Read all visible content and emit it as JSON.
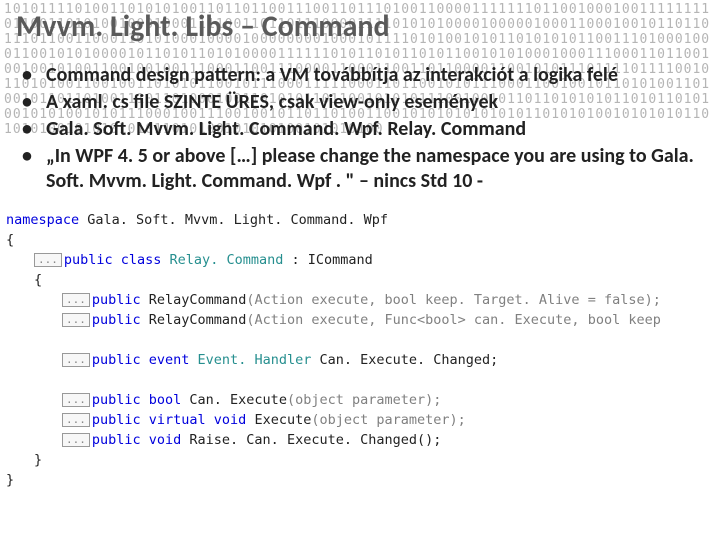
{
  "bg_binary": "10101111010011010101001101101100111001101110100110000111111101100100010011111111011001101010010001000111100110110111000011110101010000100000100011000100101101101110110011000110101000100001000000001000101111010100101011010101011001110100010001100101010000101101011010100001111110101101011010110010101000100011100011011001001001010011001001001110001100111000011000110011011000011001010111011110111100101101010011001001101010110010111000111110001101100101011100011001001011010100110100101101101001110110100010011010101101100101010111001001011011010101011010110101001010100101011100010011100100101101101001100101010101010101101010100101010101101010100101010101011010100101010100101010100",
  "title": "Mvvm. Light. Libs – Command",
  "bullets": [
    "Command design pattern: a VM továbbítja az interakciót a logika felé",
    "A xaml. cs file SZINTE ÜRES, csak view-only események",
    "Gala. Soft. Mvvm. Light. Command. Wpf. Relay. Command",
    "„In WPF 4. 5 or above […] please change the  namespace you are using to Gala. Soft. Mvvm. Light. Command. Wpf . \" – nincs Std 10 -"
  ],
  "code": {
    "ns_kw": "namespace",
    "ns_name": " Gala. Soft. Mvvm. Light. Command. Wpf",
    "brace_open": "{",
    "brace_close": "}",
    "collapse": "...",
    "class_kw": "public class",
    "class_name": " Relay. Command ",
    "class_impl": ": ICommand",
    "ctor1_mods": "public",
    "ctor1_name": " RelayCommand",
    "ctor1_params": "(Action execute, bool keep. Target. Alive = false);",
    "ctor2_mods": "public",
    "ctor2_name": " RelayCommand",
    "ctor2_params": "(Action execute, Func<bool> can. Execute, bool keep",
    "event_mods": "public event",
    "event_type": " Event. Handler ",
    "event_name": "Can. Execute. Changed;",
    "m1_mods": "public bool",
    "m1_name": " Can. Execute",
    "m1_params": "(object parameter);",
    "m2_mods": "public virtual void",
    "m2_name": " Execute",
    "m2_params": "(object parameter);",
    "m3_mods": "public void",
    "m3_name": " Raise. Can. Execute. Changed();"
  }
}
